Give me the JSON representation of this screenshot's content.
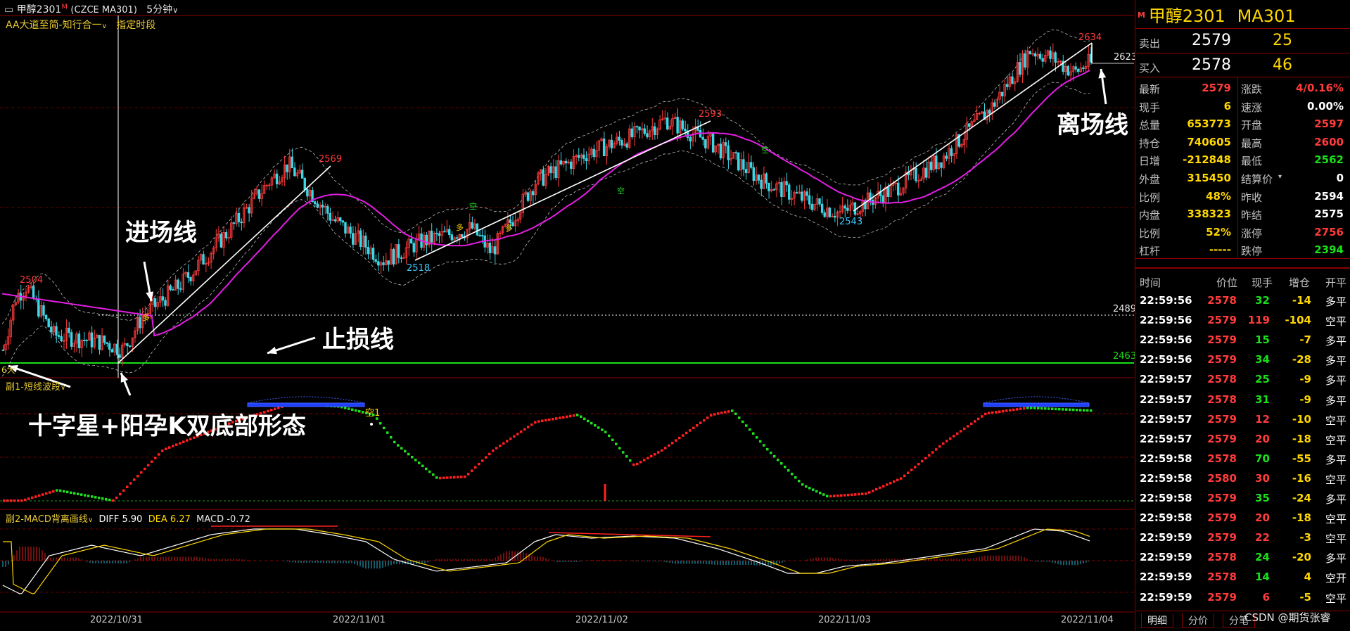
{
  "window": {
    "title": "甲醇2301",
    "title_mark": "M",
    "symbol": "(CZCE MA301)",
    "period": "5分钟"
  },
  "main_pane": {
    "indicator": "AA大道至简-知行合一",
    "indicator_option": "指定时段",
    "price_labels": {
      "p2634": "2634",
      "p2623": "2623",
      "p2593": "2593",
      "p2569": "2569",
      "p2543": "2543",
      "p2518": "2518",
      "p2504": "2504",
      "p2489": "2489",
      "p2463": "2463"
    },
    "signals": {
      "duo": "多",
      "kong": "空"
    },
    "corner": "6大"
  },
  "annotations": {
    "entry": "进场线",
    "stop": "止损线",
    "exit": "离场线",
    "pattern": "十字星+阳孕K双底部形态"
  },
  "sub1": {
    "title": "副1-短线波段",
    "signal": "空1"
  },
  "sub2": {
    "title": "副2-MACD背离画线",
    "diff": "DIFF 5.90",
    "dea": "DEA 6.27",
    "macd": "MACD -0.72"
  },
  "dates": [
    "2022/10/31",
    "2022/11/01",
    "2022/11/02",
    "2022/11/03",
    "2022/11/04"
  ],
  "quote": {
    "name": "甲醇2301",
    "code": "MA301",
    "flag": "M",
    "sell": {
      "label": "卖出",
      "price": "2579",
      "vol": "25"
    },
    "buy": {
      "label": "买入",
      "price": "2578",
      "vol": "46"
    },
    "rows": [
      {
        "l1": "最新",
        "v1": "2579",
        "c1": "red",
        "l2": "涨跌",
        "v2": "4/0.16%",
        "c2": "red"
      },
      {
        "l1": "现手",
        "v1": "6",
        "c1": "yel",
        "l2": "速涨",
        "v2": "0.00%",
        "c2": "wht"
      },
      {
        "l1": "总量",
        "v1": "653773",
        "c1": "yel",
        "l2": "开盘",
        "v2": "2597",
        "c2": "red"
      },
      {
        "l1": "持仓",
        "v1": "740605",
        "c1": "yel",
        "l2": "最高",
        "v2": "2600",
        "c2": "red"
      },
      {
        "l1": "日增",
        "v1": "-212848",
        "c1": "yel",
        "l2": "最低",
        "v2": "2562",
        "c2": "grn"
      },
      {
        "l1": "外盘",
        "v1": "315450",
        "c1": "yel",
        "l2": "结算价",
        "v2": "0",
        "c2": "wht"
      },
      {
        "l1": "比例",
        "v1": "48%",
        "c1": "yel",
        "l2": "昨收",
        "v2": "2594",
        "c2": "wht"
      },
      {
        "l1": "内盘",
        "v1": "338323",
        "c1": "yel",
        "l2": "昨结",
        "v2": "2575",
        "c2": "wht"
      },
      {
        "l1": "比例",
        "v1": "52%",
        "c1": "yel",
        "l2": "涨停",
        "v2": "2756",
        "c2": "red"
      },
      {
        "l1": "杠杆",
        "v1": "-----",
        "c1": "yel",
        "l2": "跌停",
        "v2": "2394",
        "c2": "grn"
      }
    ]
  },
  "ticks": {
    "headers": [
      "时间",
      "价位",
      "现手",
      "增仓",
      "开平"
    ],
    "rows": [
      {
        "t": "22:59:56",
        "p": "2578",
        "pc": "red",
        "v": "32",
        "vc": "grn",
        "o": "-14",
        "k": "多平"
      },
      {
        "t": "22:59:56",
        "p": "2579",
        "pc": "red",
        "v": "119",
        "vc": "red",
        "o": "-104",
        "k": "空平"
      },
      {
        "t": "22:59:56",
        "p": "2579",
        "pc": "red",
        "v": "15",
        "vc": "grn",
        "o": "-7",
        "k": "多平"
      },
      {
        "t": "22:59:56",
        "p": "2579",
        "pc": "red",
        "v": "34",
        "vc": "grn",
        "o": "-28",
        "k": "多平"
      },
      {
        "t": "22:59:57",
        "p": "2578",
        "pc": "red",
        "v": "25",
        "vc": "grn",
        "o": "-9",
        "k": "多平"
      },
      {
        "t": "22:59:57",
        "p": "2578",
        "pc": "red",
        "v": "31",
        "vc": "grn",
        "o": "-9",
        "k": "多平"
      },
      {
        "t": "22:59:57",
        "p": "2579",
        "pc": "red",
        "v": "12",
        "vc": "red",
        "o": "-10",
        "k": "空平"
      },
      {
        "t": "22:59:57",
        "p": "2579",
        "pc": "red",
        "v": "20",
        "vc": "red",
        "o": "-18",
        "k": "空平"
      },
      {
        "t": "22:59:58",
        "p": "2578",
        "pc": "red",
        "v": "70",
        "vc": "grn",
        "o": "-55",
        "k": "多平"
      },
      {
        "t": "22:59:58",
        "p": "2580",
        "pc": "red",
        "v": "30",
        "vc": "red",
        "o": "-16",
        "k": "空平"
      },
      {
        "t": "22:59:58",
        "p": "2579",
        "pc": "red",
        "v": "35",
        "vc": "grn",
        "o": "-24",
        "k": "多平"
      },
      {
        "t": "22:59:58",
        "p": "2579",
        "pc": "red",
        "v": "20",
        "vc": "red",
        "o": "-18",
        "k": "空平"
      },
      {
        "t": "22:59:59",
        "p": "2579",
        "pc": "red",
        "v": "22",
        "vc": "red",
        "o": "-3",
        "k": "空平"
      },
      {
        "t": "22:59:59",
        "p": "2578",
        "pc": "red",
        "v": "24",
        "vc": "grn",
        "o": "-20",
        "k": "多平"
      },
      {
        "t": "22:59:59",
        "p": "2578",
        "pc": "red",
        "v": "14",
        "vc": "grn",
        "o": "4",
        "k": "空开"
      },
      {
        "t": "22:59:59",
        "p": "2579",
        "pc": "red",
        "v": "6",
        "vc": "red",
        "o": "-5",
        "k": "空平"
      }
    ]
  },
  "bottom_tabs": [
    "明细",
    "分价",
    "分笔"
  ],
  "watermark": "CSDN @期货张睿"
}
